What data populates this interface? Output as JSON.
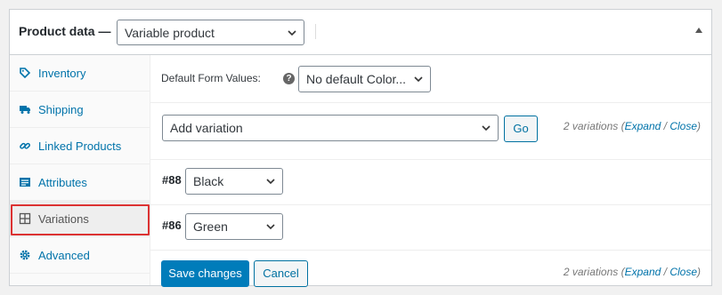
{
  "header": {
    "title": "Product data —",
    "product_type": "Variable product"
  },
  "sidebar": {
    "items": [
      {
        "label": "Inventory",
        "icon": "tag-icon"
      },
      {
        "label": "Shipping",
        "icon": "truck-icon"
      },
      {
        "label": "Linked Products",
        "icon": "link-icon"
      },
      {
        "label": "Attributes",
        "icon": "list-icon"
      },
      {
        "label": "Variations",
        "icon": "grid-icon",
        "active": true
      },
      {
        "label": "Advanced",
        "icon": "gear-icon"
      }
    ]
  },
  "defaults": {
    "label": "Default Form Values:",
    "help": "?",
    "value": "No default Color..."
  },
  "toolbar": {
    "add_option": "Add variation",
    "go_label": "Go",
    "count_text": "2 variations",
    "expand": "Expand",
    "slash": " / ",
    "close": "Close"
  },
  "variations": [
    {
      "number": "#88",
      "value": "Black"
    },
    {
      "number": "#86",
      "value": "Green"
    }
  ],
  "footer": {
    "save_label": "Save changes",
    "cancel_label": "Cancel",
    "count_text": "2 variations",
    "expand": "Expand",
    "slash": " / ",
    "close": "Close"
  },
  "colors": {
    "primary": "#007cba",
    "link": "#0073aa",
    "highlight": "#dc3232"
  }
}
